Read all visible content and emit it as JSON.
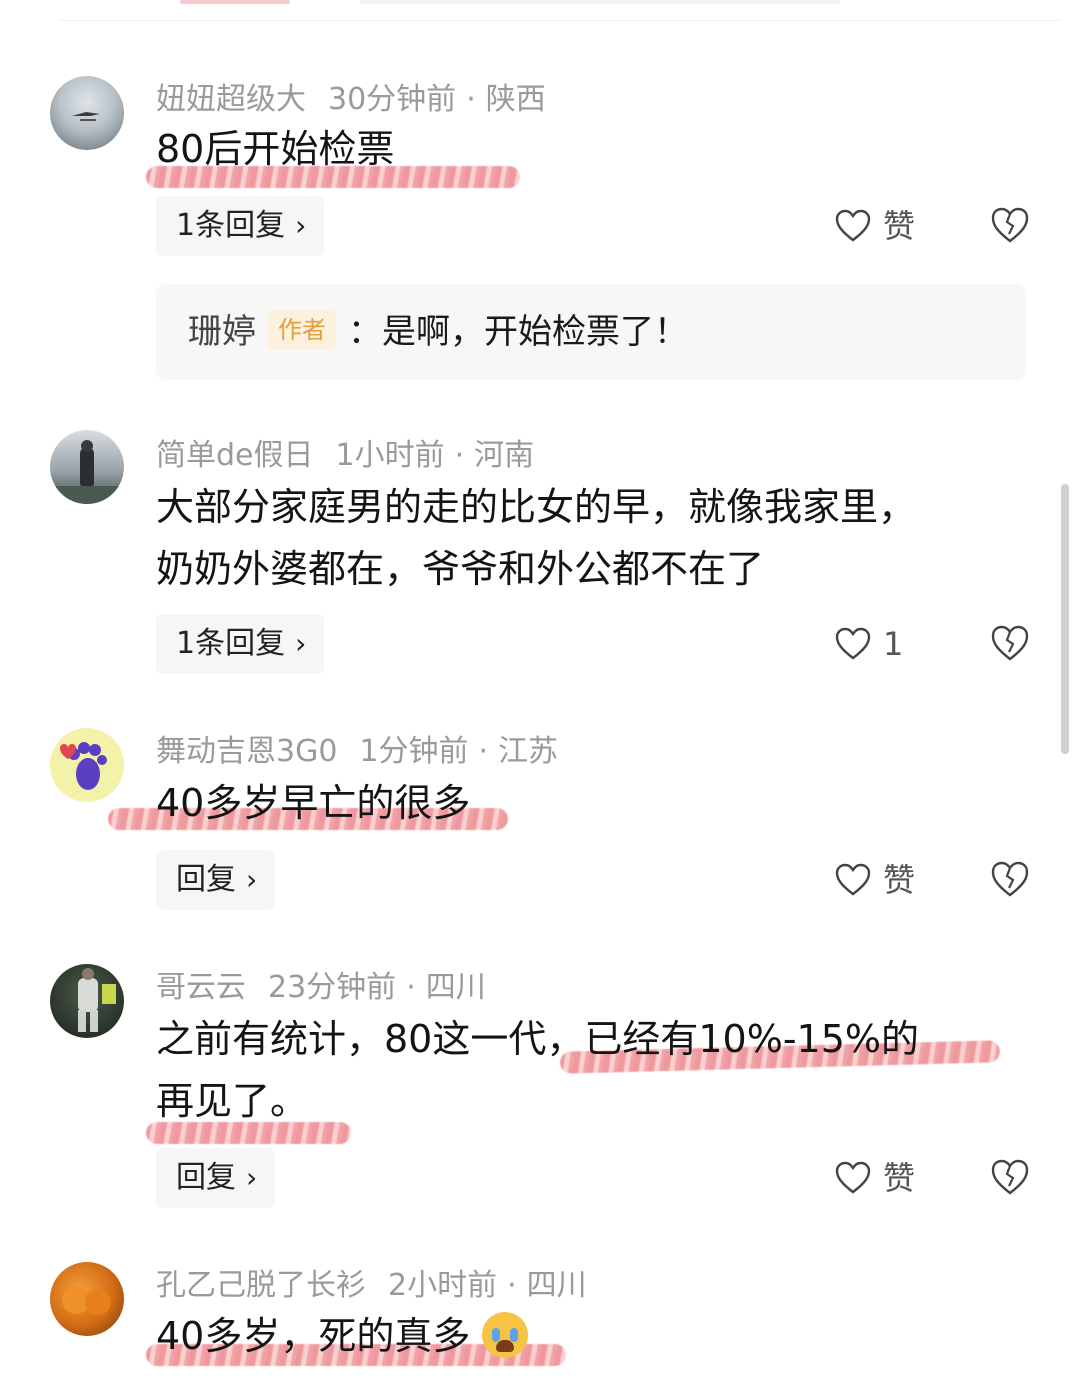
{
  "comments": [
    {
      "username": "妞妞超级大",
      "time": "30分钟前",
      "location": "陕西",
      "text": "80后开始检票",
      "reply_label": "1条回复",
      "like_label": "赞",
      "author_reply": {
        "name": "珊婷",
        "badge": "作者",
        "text": "：是啊，开始检票了！"
      }
    },
    {
      "username": "简单de假日",
      "time": "1小时前",
      "location": "河南",
      "text_line1": "大部分家庭男的走的比女的早，就像我家里，",
      "text_line2": "奶奶外婆都在，爷爷和外公都不在了",
      "reply_label": "1条回复",
      "like_label": "1"
    },
    {
      "username": "舞动吉恩3G0",
      "time": "1分钟前",
      "location": "江苏",
      "text": "40多岁早亡的很多",
      "reply_label": "回复",
      "like_label": "赞"
    },
    {
      "username": "哥云云",
      "time": "23分钟前",
      "location": "四川",
      "text_line1": "之前有统计，80这一代，已经有10%-15%的",
      "text_line2": "再见了。",
      "reply_label": "回复",
      "like_label": "赞"
    },
    {
      "username": "孔乙己脱了长衫",
      "time": "2小时前",
      "location": "四川",
      "text": "40多岁，死的真多"
    }
  ],
  "chevron": "›",
  "dot": "·",
  "icons": {
    "like": "heart-outline-icon",
    "dislike": "broken-heart-icon"
  },
  "colors": {
    "scribble": "#e2464e",
    "meta": "#9a9a9a",
    "badge": "#e2a03f"
  }
}
